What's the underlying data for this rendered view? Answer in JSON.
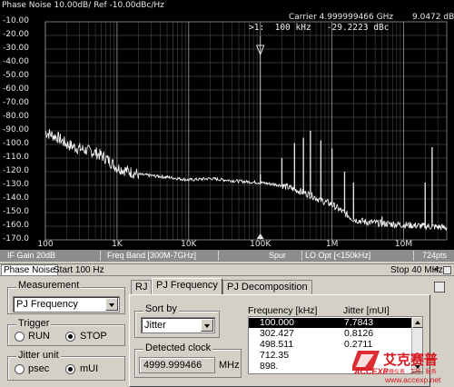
{
  "graph": {
    "title": "Phase Noise 10.00dB/ Ref -10.00dBc/Hz",
    "carrier": "Carrier 4.999999466 GHz",
    "carrier_level": "9.0472 dBm",
    "marker": ">1:  100 kHz   -29.2223 dBc",
    "marker_tag": "1"
  },
  "chart_data": {
    "type": "line",
    "xscale": "log",
    "xlim": [
      100,
      40000000
    ],
    "ylim": [
      -170,
      -10
    ],
    "grid": true,
    "y_tick_labels": [
      "-10.00",
      "-20.00",
      "-30.00",
      "-40.00",
      "-50.00",
      "-60.00",
      "-70.00",
      "-80.00",
      "-90.00",
      "-100.0",
      "-110.0",
      "-120.0",
      "-130.0",
      "-140.0",
      "-150.0",
      "-160.0",
      "-170.0"
    ],
    "x_tick_labels": [
      "100",
      "1K",
      "10K",
      "100K",
      "1M",
      "10M"
    ],
    "x_ticks": [
      100,
      1000,
      10000,
      100000,
      1000000,
      10000000
    ],
    "series": [
      {
        "x": [
          100,
          150,
          200,
          300,
          500,
          700,
          1000,
          2000,
          5000,
          10000,
          20000,
          50000,
          100000,
          200000,
          300000,
          500000,
          700000,
          1000000,
          2000000,
          3000000,
          5000000,
          10000000,
          20000000,
          40000000
        ],
        "y": [
          -91,
          -95,
          -100,
          -103,
          -106,
          -110,
          -117,
          -122,
          -124,
          -126,
          -125,
          -127,
          -128,
          -130,
          -133,
          -137,
          -141,
          -144,
          -155,
          -157,
          -158,
          -159,
          -160,
          -161
        ]
      }
    ],
    "spurs": [
      {
        "x": 100000,
        "y": -122
      },
      {
        "x": 200000,
        "y": -110
      },
      {
        "x": 300000,
        "y": -99
      },
      {
        "x": 400000,
        "y": -95
      },
      {
        "x": 500000,
        "y": -90
      },
      {
        "x": 700000,
        "y": -97
      },
      {
        "x": 1000000,
        "y": -103
      },
      {
        "x": 1500000,
        "y": -120
      },
      {
        "x": 2000000,
        "y": -128
      },
      {
        "x": 5000000,
        "y": -153
      },
      {
        "x": 20000000,
        "y": -128
      },
      {
        "x": 25000000,
        "y": -102
      }
    ]
  },
  "statusbar": {
    "if_gain": "IF Gain 20dB",
    "freq_band": "Freq Band [300M-7GHz]",
    "spur": "Spur",
    "lo_opt": "LO Opt [<150kHz]",
    "points": "724pts"
  },
  "infobar": {
    "tab": "Phase Noise",
    "start": "Start 100 Hz",
    "stop": "Stop 40 MHz",
    "stop_suffix": "#"
  },
  "measurement": {
    "label": "Measurement",
    "value": "PJ Frequency"
  },
  "trigger": {
    "label": "Trigger",
    "run": "RUN",
    "stop": "STOP",
    "selected": "STOP"
  },
  "jitter_unit": {
    "label": "Jitter unit",
    "psec": "psec",
    "mui": "mUI",
    "selected": "mUI"
  },
  "tabs": [
    "RJ",
    "PJ Frequency",
    "PJ Decomposition"
  ],
  "sort_by": {
    "label": "Sort by",
    "value": "Jitter"
  },
  "detected_clock": {
    "label": "Detected clock",
    "value": "4999.999466",
    "unit": "MHz"
  },
  "pj_table": {
    "headers": [
      "Frequency [kHz]",
      "Jitter [mUI]"
    ],
    "rows": [
      [
        "100.000",
        "7.7843"
      ],
      [
        "302.427",
        "0.8126"
      ],
      [
        "498.511",
        "0.2711"
      ],
      [
        "712.35",
        ""
      ],
      [
        "898.",
        ""
      ]
    ]
  },
  "watermark": {
    "brand": "艾克赛普",
    "logo_letters": "ACCEXP",
    "url": "www.accexp.net",
    "tagline": "仪器仪表 · 工程 · 服务"
  },
  "colors": {
    "background": "#000000",
    "trace": "#ffffff",
    "grid": "#6a6a6a",
    "statusbar": "#8c8c8c",
    "panel": "#d4d0c8",
    "brand_red": "#d8161e"
  }
}
